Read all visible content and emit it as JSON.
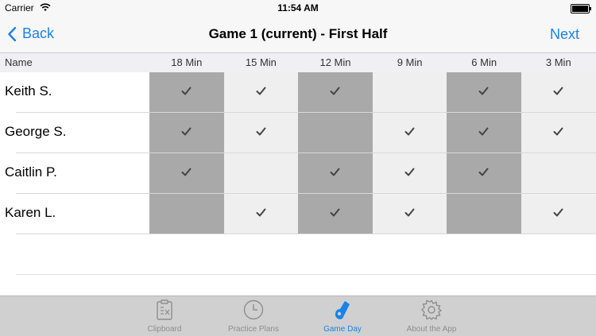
{
  "status_bar": {
    "carrier": "Carrier",
    "time": "11:54 AM"
  },
  "nav": {
    "back_label": "Back",
    "title": "Game 1 (current) - First Half",
    "next_label": "Next"
  },
  "table": {
    "name_header": "Name",
    "columns": [
      "18 Min",
      "15 Min",
      "12 Min",
      "9 Min",
      "6 Min",
      "3 Min"
    ],
    "rows": [
      {
        "name": "Keith S.",
        "checks": [
          true,
          true,
          true,
          false,
          true,
          true
        ]
      },
      {
        "name": "George S.",
        "checks": [
          true,
          true,
          false,
          true,
          true,
          true
        ]
      },
      {
        "name": "Caitlin P.",
        "checks": [
          true,
          false,
          true,
          true,
          true,
          false
        ]
      },
      {
        "name": "Karen L.",
        "checks": [
          false,
          true,
          true,
          true,
          false,
          true
        ]
      }
    ]
  },
  "tabs": [
    {
      "label": "Clipboard",
      "icon": "clipboard-icon",
      "active": false
    },
    {
      "label": "Practice Plans",
      "icon": "clock-icon",
      "active": false
    },
    {
      "label": "Game Day",
      "icon": "whistle-icon",
      "active": true
    },
    {
      "label": "About the App",
      "icon": "gear-icon",
      "active": false
    }
  ],
  "colors": {
    "accent": "#1a82e8",
    "shaded_column": "#a9a9a9",
    "light_column": "#efefef"
  }
}
